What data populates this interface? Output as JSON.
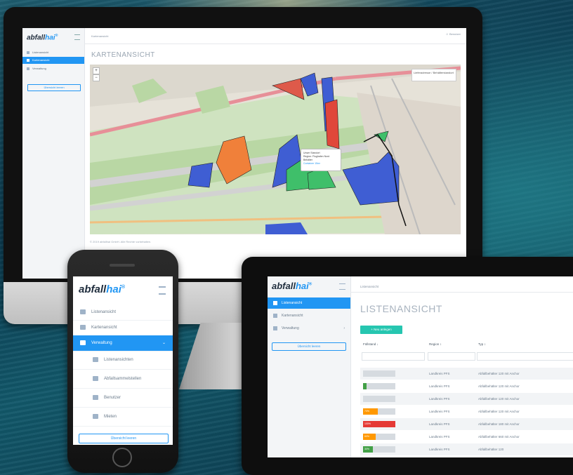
{
  "desktop": {
    "logo_main": "abfall",
    "logo_accent": "hai",
    "logo_mark": "®",
    "nav": [
      {
        "label": "Listenansicht",
        "active": false
      },
      {
        "label": "Kartenansicht",
        "active": true
      },
      {
        "label": "Verwaltung",
        "active": false
      }
    ],
    "sidebar_button": "Übersicht leeren",
    "breadcrumb": "Kartenansicht",
    "user": "Benutzer",
    "page_title": "KARTENANSICHT",
    "map_legend": "Lieferadresse / Behälterstandort",
    "popup_lines": [
      "Unser Standort",
      "Region: Flughafen Nord",
      "Behälter",
      "Container 15m³"
    ],
    "footer": "© 2019 abfallhai GmbH. Alle Rechte vorbehalten."
  },
  "phone": {
    "logo_main": "abfall",
    "logo_accent": "hai",
    "logo_mark": "®",
    "nav": [
      {
        "label": "Listenansicht",
        "active": false,
        "sub": false,
        "icon": "list-icon"
      },
      {
        "label": "Kartenansicht",
        "active": false,
        "sub": false,
        "icon": "map-pin-icon"
      },
      {
        "label": "Verwaltung",
        "active": true,
        "sub": false,
        "icon": "settings-icon"
      },
      {
        "label": "Listenansichten",
        "active": false,
        "sub": true,
        "icon": "list-icon"
      },
      {
        "label": "Abfallsammelstellen",
        "active": false,
        "sub": true,
        "icon": "map-pin-icon"
      },
      {
        "label": "Benutzer",
        "active": false,
        "sub": true,
        "icon": "user-icon"
      },
      {
        "label": "Mieten",
        "active": false,
        "sub": true,
        "icon": "truck-icon"
      }
    ],
    "sidebar_button": "Übersicht leeren"
  },
  "tablet": {
    "logo_main": "abfall",
    "logo_accent": "hai",
    "logo_mark": "®",
    "nav": [
      {
        "label": "Listenansicht",
        "active": true
      },
      {
        "label": "Kartenansicht",
        "active": false
      },
      {
        "label": "Verwaltung",
        "active": false
      }
    ],
    "sidebar_button": "Übersicht leeren",
    "breadcrumb": "Listenansicht",
    "page_title": "LISTENANSICHT",
    "create_button": "+ Neu anlegen",
    "columns": [
      "Füllstand ↓",
      "Region ↕",
      "Typ ↕"
    ],
    "rows": [
      {
        "fill": 0,
        "fill_label": "",
        "color": "#d6dbe0",
        "region": "Landkreis PFS",
        "type": "Abfallbehälter 120 mit Anchor"
      },
      {
        "fill": 10,
        "fill_label": "",
        "color": "#43a047",
        "region": "Landkreis PFS",
        "type": "Abfallbehälter 120 mit Anchor"
      },
      {
        "fill": 0,
        "fill_label": "",
        "color": "#d6dbe0",
        "region": "Landkreis PFS",
        "type": "Abfallbehälter 120 mit Anchor"
      },
      {
        "fill": 45,
        "fill_label": "70%",
        "color": "#ff9800",
        "region": "Landkreis PFS",
        "type": "Abfallbehälter 120 mit Anchor"
      },
      {
        "fill": 100,
        "fill_label": "100%",
        "color": "#e53935",
        "region": "Landkreis PFS",
        "type": "Abfallbehälter 180 mit Anchor"
      },
      {
        "fill": 40,
        "fill_label": "60%",
        "color": "#ff9800",
        "region": "Landkreis PFS",
        "type": "Abfallbehälter 660 mit Anchor"
      },
      {
        "fill": 30,
        "fill_label": "30%",
        "color": "#43a047",
        "region": "Landkreis PFS",
        "type": "Abfallbehälter 120"
      }
    ]
  }
}
